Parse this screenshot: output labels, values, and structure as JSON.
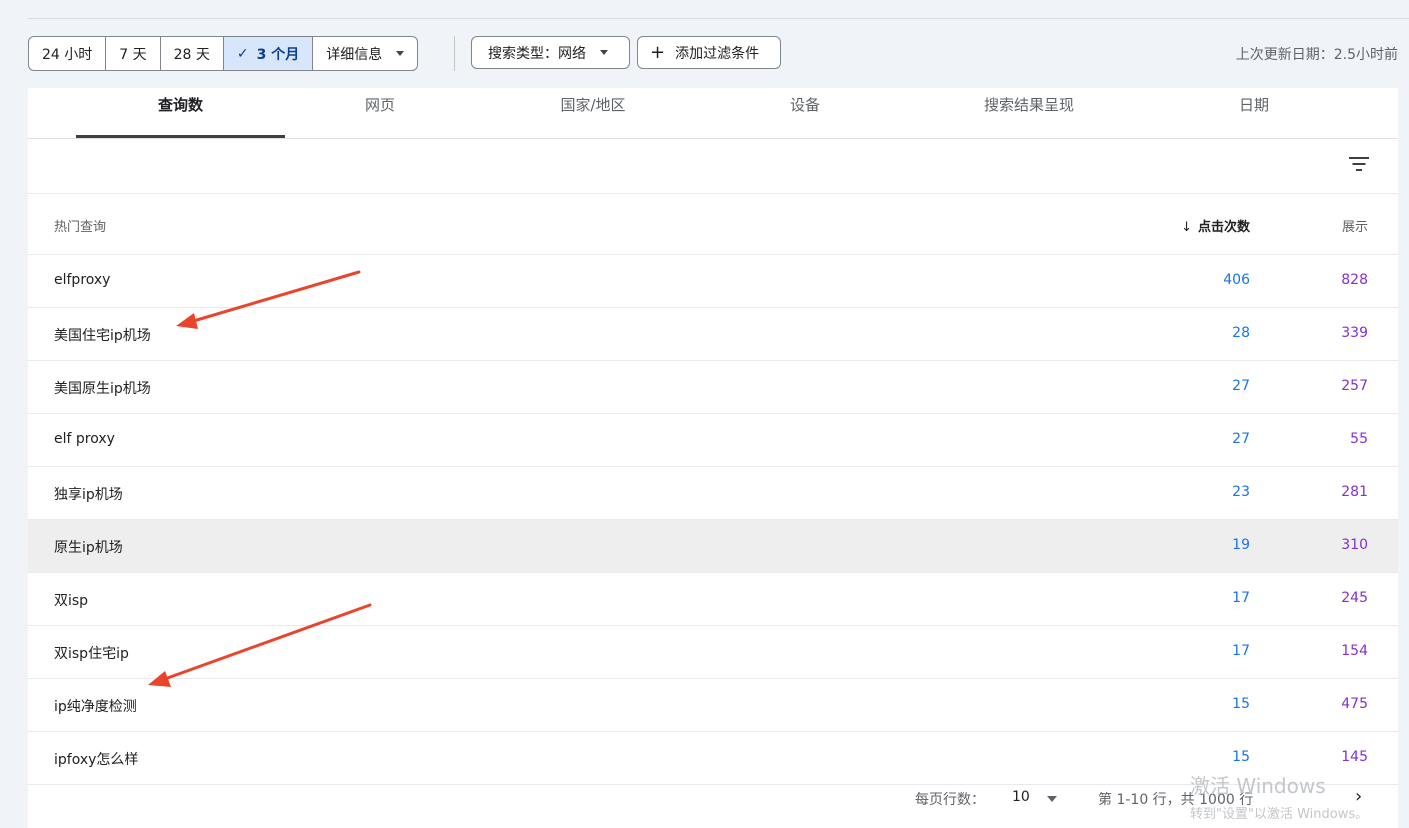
{
  "filters": {
    "date_ranges": [
      {
        "label": "24 小时",
        "selected": false
      },
      {
        "label": "7 天",
        "selected": false
      },
      {
        "label": "28 天",
        "selected": false
      },
      {
        "label": "3 个月",
        "selected": true
      },
      {
        "label": "详细信息",
        "selected": false
      }
    ],
    "search_type": "搜索类型：网络",
    "add_filter": "添加过滤条件",
    "last_updated": "上次更新日期：2.5小时前"
  },
  "tabs": [
    "查询数",
    "网页",
    "国家/地区",
    "设备",
    "搜索结果呈现",
    "日期"
  ],
  "active_tab": "查询数",
  "table": {
    "headers": {
      "query": "热门查询",
      "clicks": "点击次数",
      "impressions": "展示"
    },
    "rows": [
      {
        "query": "elfproxy",
        "clicks": "406",
        "impressions": "828"
      },
      {
        "query": "美国住宅ip机场",
        "clicks": "28",
        "impressions": "339"
      },
      {
        "query": "美国原生ip机场",
        "clicks": "27",
        "impressions": "257"
      },
      {
        "query": "elf proxy",
        "clicks": "27",
        "impressions": "55"
      },
      {
        "query": "独享ip机场",
        "clicks": "23",
        "impressions": "281"
      },
      {
        "query": "原生ip机场",
        "clicks": "19",
        "impressions": "310"
      },
      {
        "query": "双isp",
        "clicks": "17",
        "impressions": "245"
      },
      {
        "query": "双isp住宅ip",
        "clicks": "17",
        "impressions": "154"
      },
      {
        "query": "ip纯净度检测",
        "clicks": "15",
        "impressions": "475"
      },
      {
        "query": "ipfoxy怎么样",
        "clicks": "15",
        "impressions": "145"
      }
    ],
    "highlighted_row": 5
  },
  "pagination": {
    "rows_per_page_label": "每页行数：",
    "rows_per_page": "10",
    "range": "第 1-10 行，共 1000 行"
  },
  "watermark": {
    "line1": "激活 Windows",
    "line2": "转到\"设置\"以激活 Windows。"
  },
  "colors": {
    "clicks": "#1a73e8",
    "impressions": "#8430ce",
    "annotation_arrow": "#e8452c",
    "selected_chip": "#d7e6fb"
  }
}
